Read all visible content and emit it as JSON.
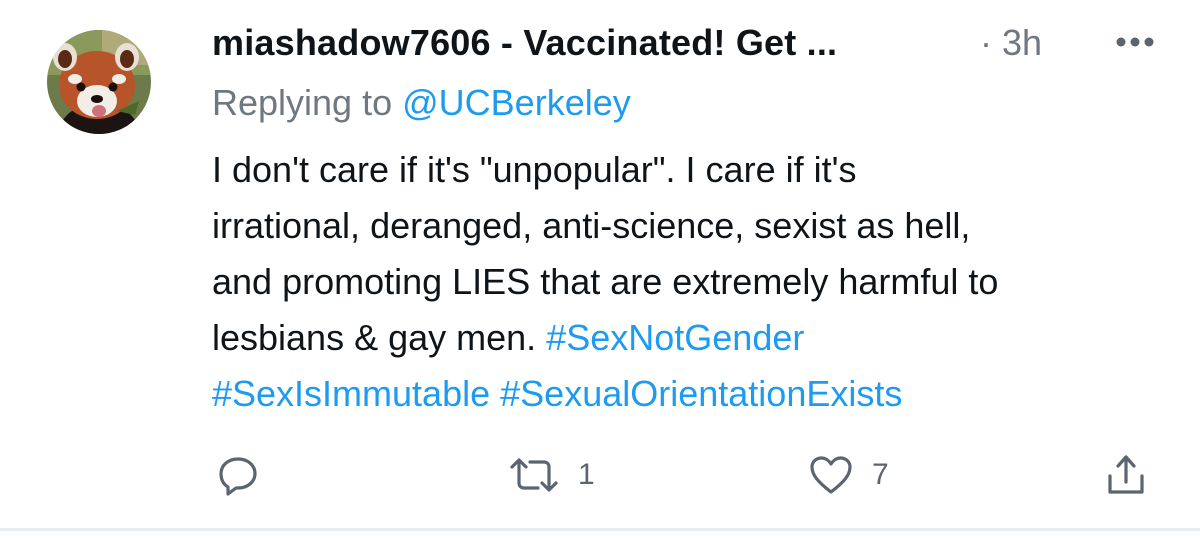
{
  "tweet": {
    "author_display": "miashadow7606 - Vaccinated! Get ...",
    "separator": "·",
    "timestamp": "3h",
    "more_icon": "more-horizontal-icon",
    "replying_prefix": "Replying to",
    "replying_handle": "@UCBerkeley",
    "text_lines": {
      "line1": "I don't care if it's \"unpopular\". I care if it's",
      "line2": "irrational, deranged, anti-science, sexist as hell,",
      "line3": "and promoting LIES that are extremely harmful to",
      "line4_text": "lesbians & gay men.",
      "line4_tag": "#SexNotGender",
      "line5_tag1": "#SexIsImmutable",
      "line5_tag2": "#SexualOrientationExists"
    },
    "actions": {
      "reply_icon": "reply-icon",
      "retweet_icon": "retweet-icon",
      "retweet_count": "1",
      "like_icon": "heart-icon",
      "like_count": "7",
      "share_icon": "share-icon"
    },
    "colors": {
      "link": "#1d9bf0",
      "secondary_text": "#6f7780",
      "primary_text": "#0f1419"
    }
  }
}
